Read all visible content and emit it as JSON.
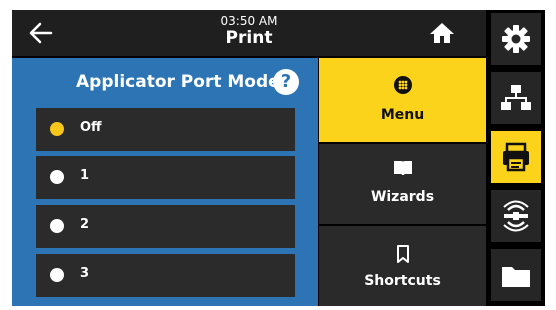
{
  "header": {
    "time": "03:50 AM",
    "title": "Print"
  },
  "panel": {
    "title": "Applicator Port Mode",
    "help_label": "?",
    "options": [
      {
        "label": "Off",
        "selected": true
      },
      {
        "label": "1",
        "selected": false
      },
      {
        "label": "2",
        "selected": false
      },
      {
        "label": "3",
        "selected": false
      }
    ]
  },
  "menu": {
    "items": [
      {
        "label": "Menu",
        "icon": "dots-grid-icon",
        "active": true
      },
      {
        "label": "Wizards",
        "icon": "book-icon",
        "active": false
      },
      {
        "label": "Shortcuts",
        "icon": "bookmark-icon",
        "active": false
      }
    ]
  },
  "rail": {
    "items": [
      {
        "icon": "settings-gear-icon",
        "active": false
      },
      {
        "icon": "network-icon",
        "active": false
      },
      {
        "icon": "printer-icon",
        "active": true
      },
      {
        "icon": "rfid-icon",
        "active": false
      },
      {
        "icon": "folder-icon",
        "active": false
      }
    ]
  },
  "colors": {
    "accent": "#fbd31a",
    "panel": "#2d74b4",
    "dark": "#2b2b2b"
  }
}
